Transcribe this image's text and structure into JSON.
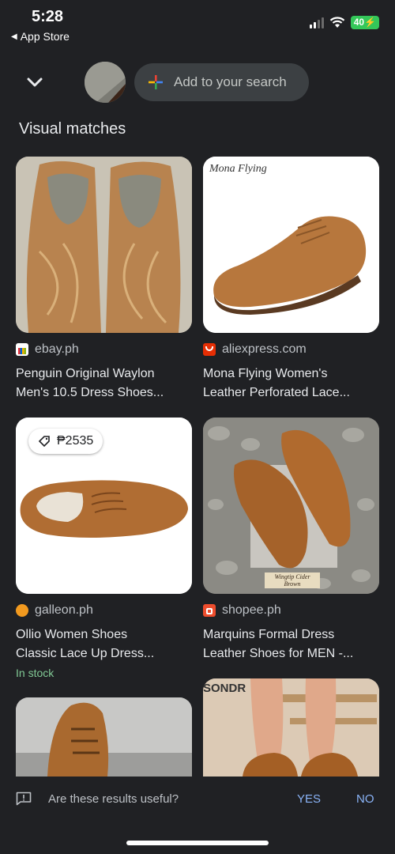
{
  "status_bar": {
    "time": "5:28",
    "back_app": "App Store",
    "battery": "40"
  },
  "search": {
    "placeholder": "Add to your search"
  },
  "section_title": "Visual matches",
  "results": [
    {
      "source": "ebay.ph",
      "title_line1": "Penguin Original Waylon",
      "title_line2": "Men's 10.5 Dress Shoes..."
    },
    {
      "source": "aliexpress.com",
      "title_line1": "Mona Flying Women's",
      "title_line2": "Leather Perforated Lace...",
      "image_brand": "Mona Flying"
    },
    {
      "source": "galleon.ph",
      "price": "₱2535",
      "title_line1": "Ollio Women Shoes",
      "title_line2": "Classic Lace Up Dress...",
      "stock": "In stock"
    },
    {
      "source": "shopee.ph",
      "title_line1": "Marquins Formal Dress",
      "title_line2": "Leather Shoes for MEN -...",
      "image_caption": "Wingtip Cider Brown"
    },
    {
      "source": "",
      "title_line1": "",
      "title_line2": ""
    },
    {
      "source": "",
      "title_line1": "",
      "title_line2": "",
      "image_brand": "SONDR"
    }
  ],
  "feedback": {
    "question": "Are these results useful?",
    "yes": "YES",
    "no": "NO"
  },
  "colors": {
    "background": "#202124",
    "link": "#8ab4f8",
    "stock": "#81c995",
    "pill": "#3c4043"
  }
}
